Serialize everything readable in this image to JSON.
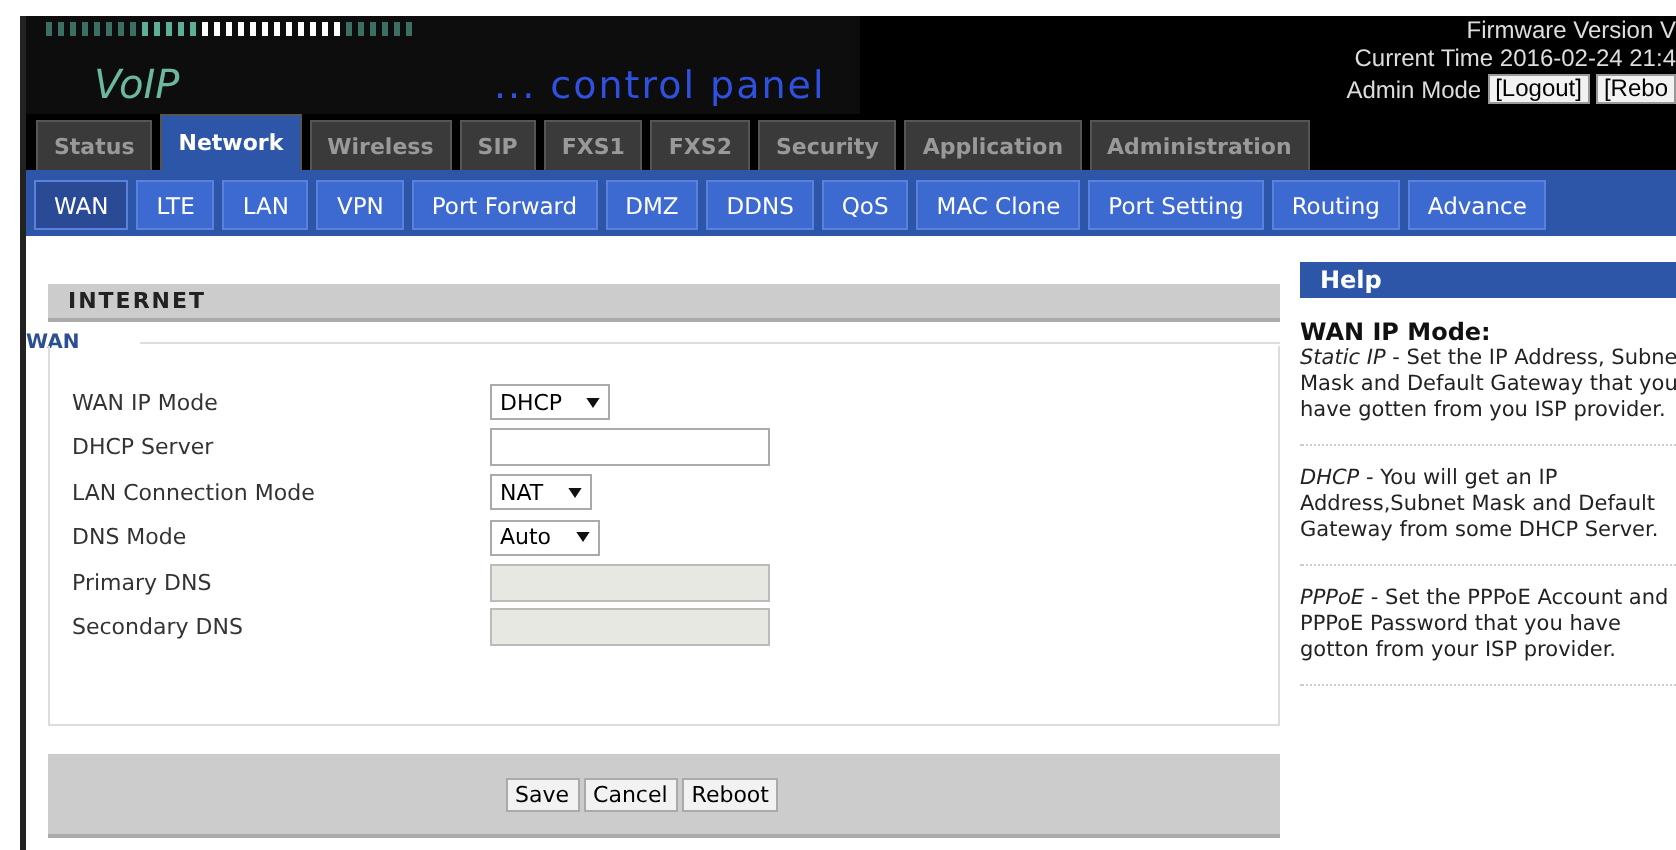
{
  "header": {
    "logo": "VoIP",
    "tagline": "... control panel",
    "firmware": "Firmware Version V",
    "time": "Current Time 2016-02-24 21:4",
    "mode": "Admin Mode",
    "buttons": [
      "[Logout]",
      "[Rebo"
    ]
  },
  "tabs": [
    {
      "label": "Status",
      "selected": false
    },
    {
      "label": "Network",
      "selected": true
    },
    {
      "label": "Wireless",
      "selected": false
    },
    {
      "label": "SIP",
      "selected": false
    },
    {
      "label": "FXS1",
      "selected": false
    },
    {
      "label": "FXS2",
      "selected": false
    },
    {
      "label": "Security",
      "selected": false
    },
    {
      "label": "Application",
      "selected": false
    },
    {
      "label": "Administration",
      "selected": false
    }
  ],
  "subtabs": [
    {
      "label": "WAN",
      "selected": true
    },
    {
      "label": "LTE",
      "selected": false
    },
    {
      "label": "LAN",
      "selected": false
    },
    {
      "label": "VPN",
      "selected": false
    },
    {
      "label": "Port Forward",
      "selected": false
    },
    {
      "label": "DMZ",
      "selected": false
    },
    {
      "label": "DDNS",
      "selected": false
    },
    {
      "label": "QoS",
      "selected": false
    },
    {
      "label": "MAC Clone",
      "selected": false
    },
    {
      "label": "Port Setting",
      "selected": false
    },
    {
      "label": "Routing",
      "selected": false
    },
    {
      "label": "Advance",
      "selected": false
    }
  ],
  "section": "INTERNET",
  "legend": "WAN",
  "fields": [
    {
      "label": "WAN IP Mode",
      "kind": "select",
      "value": "DHCP"
    },
    {
      "label": "DHCP Server",
      "kind": "text",
      "disabled": false
    },
    {
      "label": "LAN Connection Mode",
      "kind": "select",
      "value": "NAT"
    },
    {
      "label": "DNS Mode",
      "kind": "select",
      "value": "Auto"
    },
    {
      "label": "Primary DNS",
      "kind": "text",
      "disabled": true
    },
    {
      "label": "Secondary DNS",
      "kind": "text",
      "disabled": true
    }
  ],
  "actions": [
    "Save",
    "Cancel",
    "Reboot"
  ],
  "help": {
    "title": "Help",
    "heading": "WAN IP Mode:",
    "items": [
      "*Static IP* - Set the IP Address, Subne\nMask and Default Gateway that you\nhave gotten from you ISP provider.",
      "*DHCP* - You will get an IP\nAddress,Subnet Mask and Default\nGateway from some DHCP Server.",
      "*PPPoE* - Set the PPPoE Account and\nPPPoE Password that you have\ngotton from your ISP provider."
    ]
  }
}
